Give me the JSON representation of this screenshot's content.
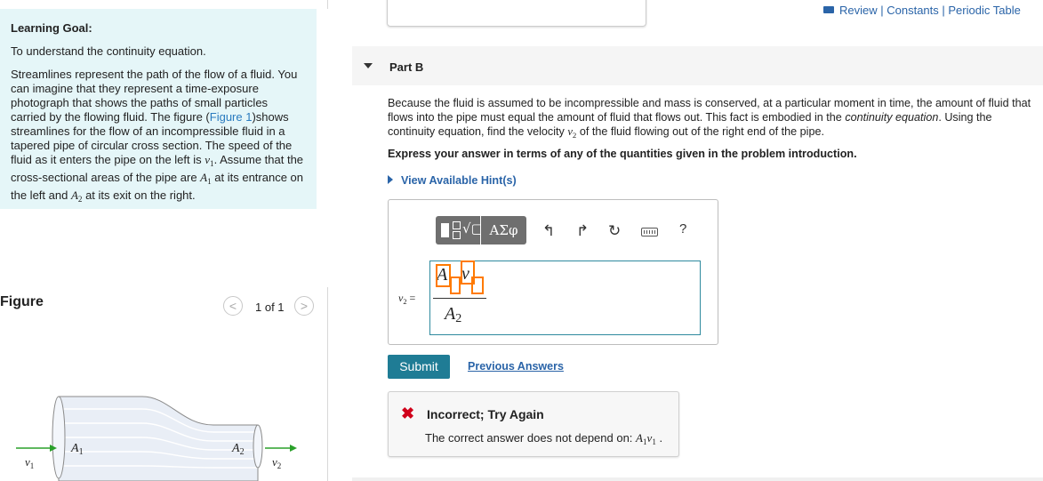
{
  "top_links": {
    "review": "Review",
    "sep": " | ",
    "constants": "Constants",
    "periodic": "Periodic Table"
  },
  "learning_goal": {
    "title": "Learning Goal:",
    "intro": "To understand the continuity equation.",
    "text_1": "Streamlines represent the path of the flow of a fluid. You can imagine that they represent a time-exposure photograph that shows the paths of small particles carried by the flowing fluid. The figure (",
    "figure_link": "Figure 1",
    "text_2": ")shows streamlines for the flow of an incompressible fluid in a tapered pipe of circular cross section. The speed of the fluid as it enters the pipe on the left is ",
    "v1_sym": "v",
    "v1_sub": "1",
    "text_3": ". Assume that the cross-sectional areas of the pipe are ",
    "a1_sym": "A",
    "a1_sub": "1",
    "text_4": " at its entrance on the left and ",
    "a2_sym": "A",
    "a2_sub": "2",
    "text_5": " at its exit on the right."
  },
  "figure": {
    "label": "Figure",
    "pager": "1 of 1",
    "prev": "<",
    "next": ">",
    "labels": {
      "a1": "A",
      "a1_sub": "1",
      "a2": "A",
      "a2_sub": "2",
      "v1": "v",
      "v1_sub": "1",
      "v2": "v",
      "v2_sub": "2"
    }
  },
  "part_b": {
    "title": "Part B",
    "question_1": "Because the fluid is assumed to be incompressible and mass is conserved, at a particular moment in time, the amount of fluid that flows into the pipe must equal the amount of fluid that flows out. This fact is embodied in the ",
    "question_em": "continuity equation",
    "question_2": ". Using the continuity equation, find the velocity ",
    "v2_sym": "v",
    "v2_sub": "2",
    "question_3": " of the fluid flowing out of the right end of the pipe.",
    "express": "Express your answer in terms of any of the quantities given in the problem introduction.",
    "hints": "View Available Hint(s)"
  },
  "answer": {
    "toolbar": {
      "greek": "ΑΣφ",
      "undo_icon": "undo-icon",
      "redo_icon": "redo-icon",
      "reset_icon": "reset-icon",
      "keyboard_icon": "keyboard-icon",
      "help": "?"
    },
    "lhs": "v",
    "lhs_sub": "2",
    "eq": " =",
    "num_a": "A",
    "num_v": "v",
    "den_a": "A",
    "den_sub": "2"
  },
  "actions": {
    "submit": "Submit",
    "previous": "Previous Answers"
  },
  "feedback": {
    "icon": "✖",
    "title": "Incorrect; Try Again",
    "msg": "The correct answer does not depend on: ",
    "msg_a": "A",
    "msg_sub1": "1",
    "msg_v": "v",
    "msg_sub2": "1",
    "msg_end": " ."
  },
  "colors": {
    "accent": "#1f7c95",
    "link": "#2a64a8",
    "goal_bg": "#e5f6f8",
    "error": "#d0021b",
    "cursor": "#ff7a00",
    "arrow": "#2aa02a"
  }
}
